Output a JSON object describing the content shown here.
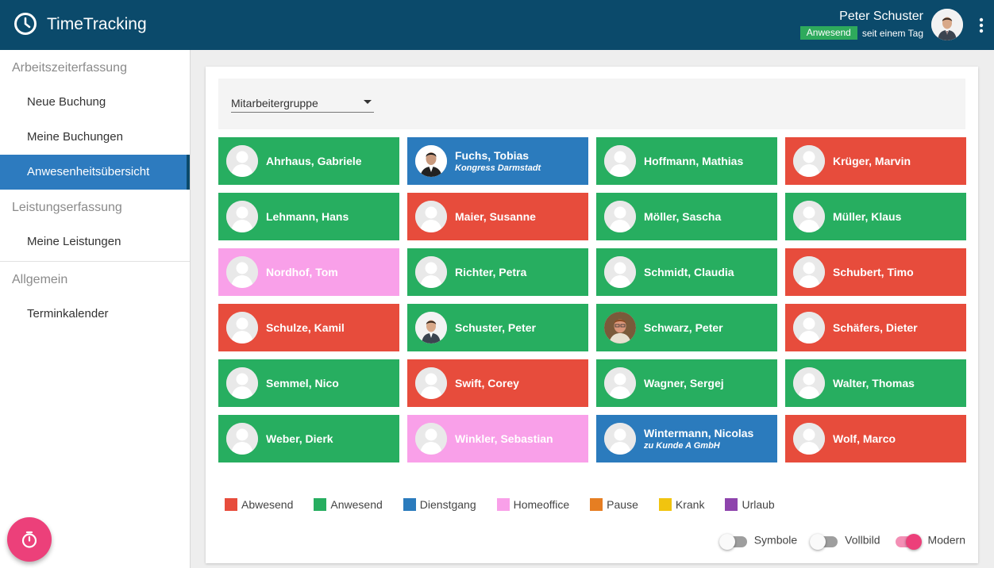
{
  "header": {
    "app_title": "TimeTracking",
    "user_name": "Peter Schuster",
    "status_badge": "Anwesend",
    "status_since": "seit einem Tag",
    "icons": {
      "logo": "clock-icon",
      "menu": "more-vert-icon"
    }
  },
  "sidebar": {
    "sections": [
      {
        "title": "Arbeitszeiterfassung",
        "items": [
          "Neue Buchung",
          "Meine Buchungen",
          "Anwesenheitsübersicht"
        ]
      },
      {
        "title": "Leistungserfassung",
        "items": [
          "Meine Leistungen"
        ]
      },
      {
        "title": "Allgemein",
        "items": [
          "Terminkalender"
        ]
      }
    ],
    "active_item": "Anwesenheitsübersicht",
    "fab_icon": "stopwatch-icon"
  },
  "filter": {
    "label": "Mitarbeitergruppe"
  },
  "employees": [
    {
      "name": "Ahrhaus, Gabriele",
      "status": "anwesend",
      "note": "",
      "photo": false
    },
    {
      "name": "Fuchs, Tobias",
      "status": "dienstgang",
      "note": "Kongress Darmstadt",
      "photo": true
    },
    {
      "name": "Hoffmann, Mathias",
      "status": "anwesend",
      "note": "",
      "photo": false
    },
    {
      "name": "Krüger, Marvin",
      "status": "abwesend",
      "note": "",
      "photo": false
    },
    {
      "name": "Lehmann, Hans",
      "status": "anwesend",
      "note": "",
      "photo": false
    },
    {
      "name": "Maier, Susanne",
      "status": "abwesend",
      "note": "",
      "photo": false
    },
    {
      "name": "Möller, Sascha",
      "status": "anwesend",
      "note": "",
      "photo": false
    },
    {
      "name": "Müller, Klaus",
      "status": "anwesend",
      "note": "",
      "photo": false
    },
    {
      "name": "Nordhof, Tom",
      "status": "homeoffice",
      "note": "",
      "photo": false
    },
    {
      "name": "Richter, Petra",
      "status": "anwesend",
      "note": "",
      "photo": false
    },
    {
      "name": "Schmidt, Claudia",
      "status": "anwesend",
      "note": "",
      "photo": false
    },
    {
      "name": "Schubert, Timo",
      "status": "abwesend",
      "note": "",
      "photo": false
    },
    {
      "name": "Schulze, Kamil",
      "status": "abwesend",
      "note": "",
      "photo": false
    },
    {
      "name": "Schuster, Peter",
      "status": "anwesend",
      "note": "",
      "photo": true
    },
    {
      "name": "Schwarz, Peter",
      "status": "anwesend",
      "note": "",
      "photo": true
    },
    {
      "name": "Schäfers, Dieter",
      "status": "abwesend",
      "note": "",
      "photo": false
    },
    {
      "name": "Semmel, Nico",
      "status": "anwesend",
      "note": "",
      "photo": false
    },
    {
      "name": "Swift, Corey",
      "status": "abwesend",
      "note": "",
      "photo": false
    },
    {
      "name": "Wagner, Sergej",
      "status": "anwesend",
      "note": "",
      "photo": false
    },
    {
      "name": "Walter, Thomas",
      "status": "anwesend",
      "note": "",
      "photo": false
    },
    {
      "name": "Weber, Dierk",
      "status": "anwesend",
      "note": "",
      "photo": false
    },
    {
      "name": "Winkler, Sebastian",
      "status": "homeoffice",
      "note": "",
      "photo": false
    },
    {
      "name": "Wintermann, Nicolas",
      "status": "dienstgang",
      "note": "zu Kunde A GmbH",
      "photo": false
    },
    {
      "name": "Wolf, Marco",
      "status": "abwesend",
      "note": "",
      "photo": false
    }
  ],
  "legend": [
    {
      "label": "Abwesend",
      "color": "#e74c3c"
    },
    {
      "label": "Anwesend",
      "color": "#27ae60"
    },
    {
      "label": "Dienstgang",
      "color": "#2b7bbd"
    },
    {
      "label": "Homeoffice",
      "color": "#f9a0e9"
    },
    {
      "label": "Pause",
      "color": "#e67e22"
    },
    {
      "label": "Krank",
      "color": "#f1c40f"
    },
    {
      "label": "Urlaub",
      "color": "#8e44ad"
    }
  ],
  "toggles": [
    {
      "label": "Symbole",
      "on": false
    },
    {
      "label": "Vollbild",
      "on": false
    },
    {
      "label": "Modern",
      "on": true
    }
  ],
  "colors": {
    "header_bg": "#0b4a6b",
    "active_nav": "#2d7bbf",
    "accent": "#ec407a"
  }
}
